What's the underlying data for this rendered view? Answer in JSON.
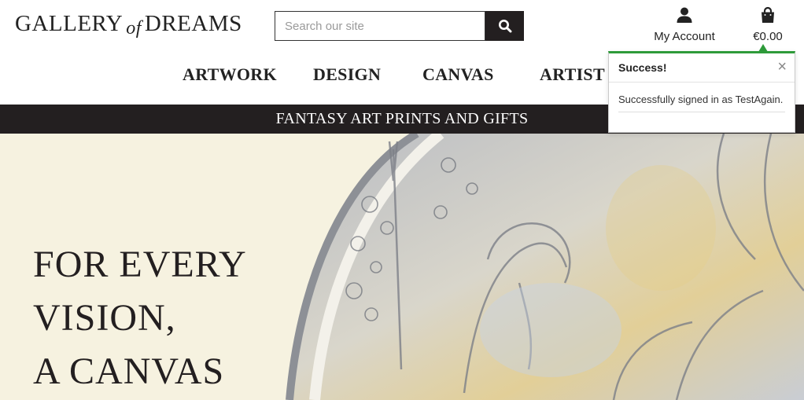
{
  "header": {
    "logo_part1": "GALLERY",
    "logo_part2": "of",
    "logo_part3": "DREAMS",
    "search": {
      "placeholder": "Search our site",
      "value": ""
    },
    "account_label": "My Account",
    "bag_total": "€0.00"
  },
  "nav": {
    "items": [
      {
        "label": "ARTWORK"
      },
      {
        "label": "DESIGN"
      },
      {
        "label": "CANVAS"
      },
      {
        "label": "ARTIST"
      }
    ]
  },
  "banner": {
    "text": "FANTASY ART PRINTS AND GIFTS"
  },
  "hero": {
    "lines": [
      "FOR EVERY",
      "VISION,",
      "A CANVAS"
    ]
  },
  "toast": {
    "title": "Success!",
    "close": "×",
    "message": "Successfully signed in as TestAgain."
  },
  "colors": {
    "dark": "#231f20",
    "hero_bg": "#f6f2e0",
    "success": "#2e9b3a"
  },
  "icons": {
    "search": "search-icon",
    "account": "user-icon",
    "bag": "shopping-bag-icon",
    "close": "close-icon"
  }
}
